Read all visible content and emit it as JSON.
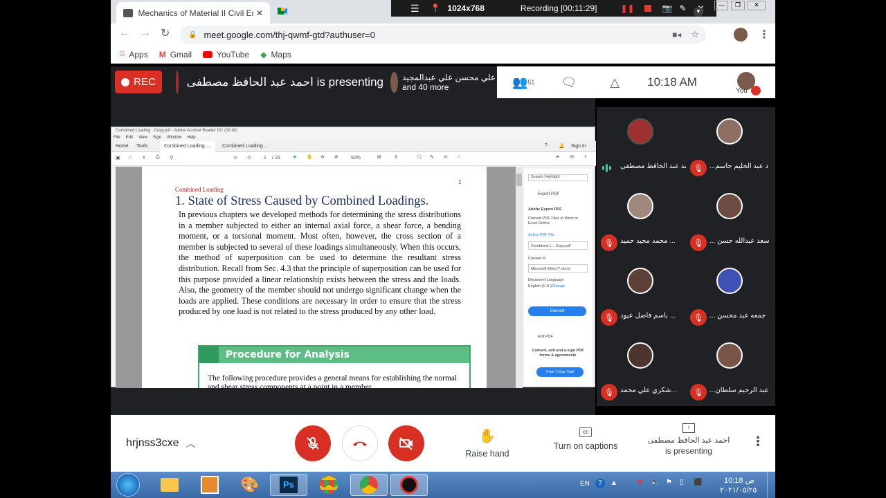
{
  "browser": {
    "tabs": [
      {
        "label": "Mechanics of Material II Civil Eng"
      },
      {
        "label": ""
      }
    ],
    "recorder": {
      "resolution": "1024x768",
      "status": "Recording [00:11:29]"
    },
    "url": "meet.google.com/thj-qwmf-gtd?authuser=0",
    "bookmarks": [
      "Apps",
      "Gmail",
      "YouTube",
      "Maps"
    ]
  },
  "meet_top": {
    "rec_label": "REC",
    "presenter_text": "احمد عبد الحافظ مصطفى is presenting",
    "notice_name": "علي محسن علي عبدالمجيد",
    "notice_more": "and 40 more",
    "participant_count": "51",
    "time": "10:18 AM",
    "you_label": "You"
  },
  "acrobat": {
    "title": "Combined Loading - Copy.pdf - Adobe Acrobat Reader DC (32-bit)",
    "menu": [
      "File",
      "Edit",
      "View",
      "Sign",
      "Window",
      "Help"
    ],
    "tabs": [
      "Home",
      "Tools",
      "Combined Loading ...",
      "Combined Loading ..."
    ],
    "sign_in": "Sign In",
    "page_indicator": "1",
    "page_total": "/ 16",
    "zoom": "50%",
    "page": {
      "header": "Combined Loading",
      "number": "1",
      "heading": "1. State of Stress Caused by Combined Loadings.",
      "body": "In previous chapters we developed methods for determining the stress distributions in a member subjected to either an internal axial force, a shear force, a bending moment, or a torsional moment. Most often, however, the cross section of a member is subjected to several of these loadings simultaneously. When this occurs, the method of superposition can be used to determine the resultant stress distribution. Recall from Sec. 4.3 that the principle of superposition can be used for this purpose provided a linear relationship exists between the stress and the loads. Also, the geometry of the member should not undergo significant change when the loads are applied. These conditions are necessary in order to ensure that the stress produced by one load is not related to the stress produced by any other load.",
      "procedure_title": "Procedure for Analysis",
      "procedure_text": "The following procedure provides a general means for establishing the normal and shear stress components at a point in a member"
    },
    "side_panel": {
      "search": "Search 'Highlight'",
      "export_pdf": "Export PDF",
      "adobe_export": "Adobe Export PDF",
      "export_desc": "Convert PDF Files to Word or Excel Online",
      "select_file": "Select PDF File",
      "file_name": "Combined L... Copy.pdf",
      "convert_to": "Convert to",
      "format": "Microsoft Word (*.docx)",
      "doc_lang": "Document Language:",
      "lang_value": "English (U.S.)",
      "change": "Change",
      "convert": "Convert",
      "edit_pdf": "Edit PDF",
      "promo": "Convert, edit and e-sign PDF forms & agreements",
      "trial": "Free 7-Day Trial"
    }
  },
  "participants": [
    {
      "name": "احمد عبد الحافظ مصطفى...",
      "speaking": true
    },
    {
      "name": "...د عبد الحليم جاسم"
    },
    {
      "name": "محمد مجيد حميد ..."
    },
    {
      "name": "... سعد عبدالله حسن"
    },
    {
      "name": "باسم فاضل عبود ..."
    },
    {
      "name": "... جمعه عبد محسن"
    },
    {
      "name": "شكري علي محمد..."
    },
    {
      "name": "...عبد الرحيم سلطان"
    }
  ],
  "bottom": {
    "meeting_code": "hrjnss3cxe",
    "raise_hand": "Raise hand",
    "captions": "Turn on captions",
    "presenter_name": "احمد عبد الحافظ مصطفى",
    "presenting": "is presenting"
  },
  "taskbar": {
    "lang": "EN",
    "time": "10:18 ص",
    "date": "٢٠٢١/٠٥/٢٥"
  },
  "colors": {
    "rec_red": "#d93025",
    "meet_dark": "#202124",
    "procedure_green": "#5dbd84",
    "taskbar_blue": "#3a6aa6"
  }
}
